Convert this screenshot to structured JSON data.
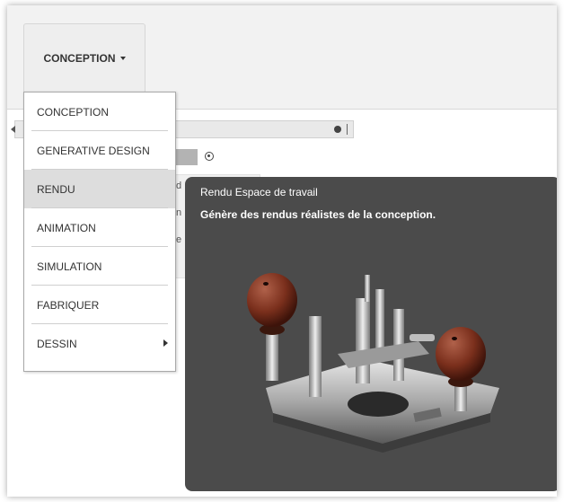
{
  "toolbar": {
    "workspace_label": "CONCEPTION"
  },
  "workspace_menu": {
    "items": [
      {
        "label": "CONCEPTION",
        "selected": false,
        "has_submenu": false
      },
      {
        "label": "GENERATIVE DESIGN",
        "selected": false,
        "has_submenu": false
      },
      {
        "label": "RENDU",
        "selected": true,
        "has_submenu": false
      },
      {
        "label": "ANIMATION",
        "selected": false,
        "has_submenu": false
      },
      {
        "label": "SIMULATION",
        "selected": false,
        "has_submenu": false
      },
      {
        "label": "FABRIQUER",
        "selected": false,
        "has_submenu": false
      },
      {
        "label": "DESSIN",
        "selected": false,
        "has_submenu": true
      }
    ]
  },
  "background": {
    "peek_1": "d",
    "peek_2": "n",
    "peek_3": "e"
  },
  "tooltip": {
    "title": "Rendu Espace de travail",
    "description": "Génère des rendus réalistes de la conception."
  },
  "colors": {
    "tooltip_bg": "#4b4b4b",
    "selected_bg": "#dddddd",
    "knob": "#7a2f1c",
    "metal": "#c8c8c8"
  }
}
